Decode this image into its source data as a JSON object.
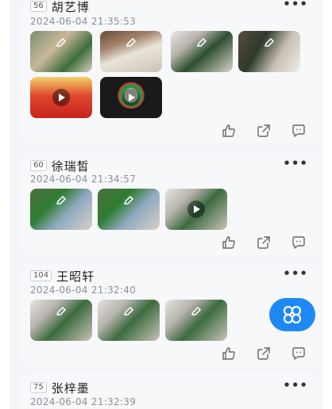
{
  "posts": [
    {
      "seat": "56",
      "name": "胡艺博",
      "time": "2024-06-04 21:35:53",
      "media_count": 6
    },
    {
      "seat": "60",
      "name": "徐瑞皙",
      "time": "2024-06-04 21:34:57",
      "media_count": 3
    },
    {
      "seat": "104",
      "name": "王昭轩",
      "time": "2024-06-04 21:32:40",
      "media_count": 3
    },
    {
      "seat": "75",
      "name": "张梓墨",
      "time": "2024-06-04 21:32:39"
    }
  ],
  "icons": {
    "more": "more-icon",
    "like": "thumbs-up-icon",
    "share": "share-icon",
    "comment": "comment-icon",
    "edit": "edit-pencil-icon",
    "play": "play-icon",
    "fab": "apps-menu-icon"
  },
  "more_label": "•••",
  "colors": {
    "accent": "#1e88f5",
    "page_bg": "#f3f5f8",
    "card_bg": "#f7f8fa",
    "time_text": "#8b8f96"
  }
}
